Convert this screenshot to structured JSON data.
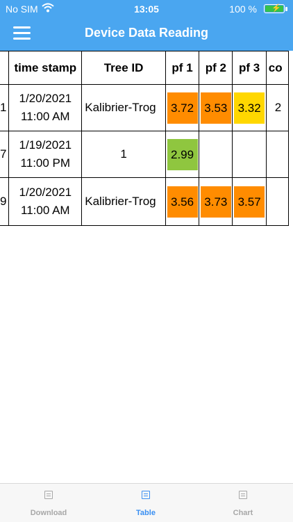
{
  "status_bar": {
    "carrier": "No SIM",
    "time": "13:05",
    "battery_pct": "100 %"
  },
  "header": {
    "title": "Device Data Reading",
    "menu_icon": "hamburger-icon"
  },
  "table": {
    "headers": [
      "time stamp",
      "Tree ID",
      "pf 1",
      "pf 2",
      "pf 3",
      "co"
    ],
    "rows": [
      {
        "idx": "1",
        "date": "1/20/2021",
        "time": "11:00 AM",
        "tree_id": "Kalibrier-Trog",
        "pf1": "3.72",
        "pf2": "3.53",
        "pf3": "3.32",
        "more": "2"
      },
      {
        "idx": "7",
        "date": "1/19/2021",
        "time": "11:00 PM",
        "tree_id": "1",
        "pf1": "2.99",
        "pf2": "",
        "pf3": "",
        "more": ""
      },
      {
        "idx": "9",
        "date": "1/20/2021",
        "time": "11:00 AM",
        "tree_id": "Kalibrier-Trog",
        "pf1": "3.56",
        "pf2": "3.73",
        "pf3": "3.57",
        "more": ""
      }
    ]
  },
  "colors": {
    "header_bg": "#4aa6f0",
    "orange": "#ff8c00",
    "yellow": "#ffd700",
    "green": "#8fc63f",
    "tab_active": "#3a8ff2",
    "tab_inactive": "#a7a7a7"
  },
  "tabs": [
    {
      "label": "Download",
      "icon": "download-icon",
      "active": false
    },
    {
      "label": "Table",
      "icon": "table-icon",
      "active": true
    },
    {
      "label": "Chart",
      "icon": "chart-icon",
      "active": false
    }
  ]
}
